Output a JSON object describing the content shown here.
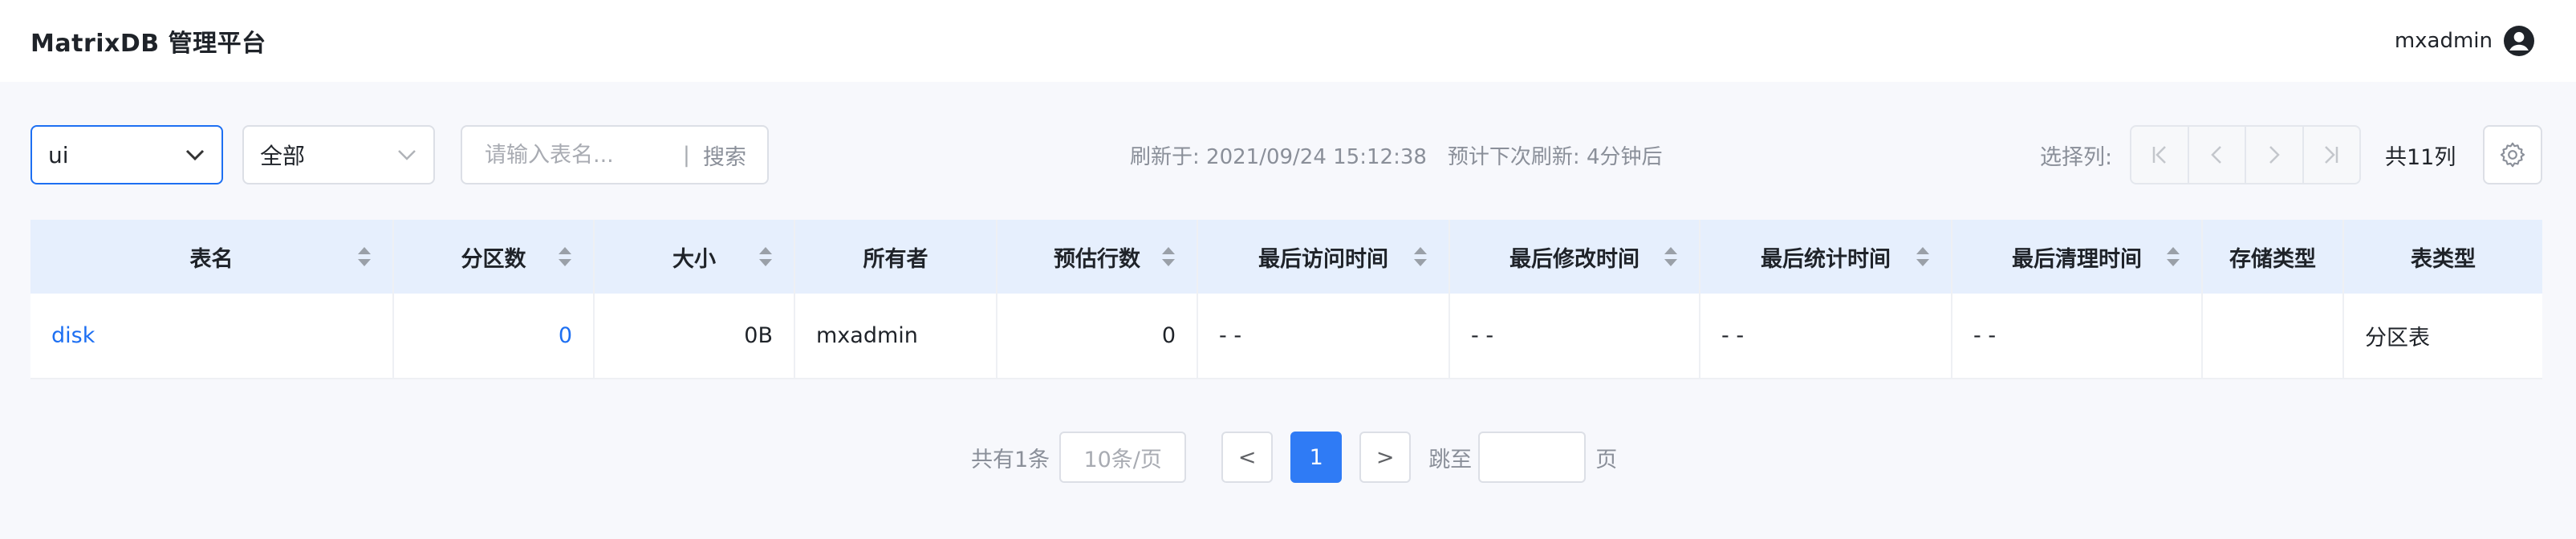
{
  "header": {
    "title": "MatrixDB 管理平台",
    "username": "mxadmin"
  },
  "toolbar": {
    "schema_value": "ui",
    "type_value": "全部",
    "search_placeholder": "请输入表名...",
    "search_button": "搜索",
    "refresh_text": "刷新于: 2021/09/24 15:12:38",
    "next_refresh_text": "预计下次刷新: 4分钟后",
    "select_columns_label": "选择列:",
    "column_count": "共11列"
  },
  "table": {
    "headers": [
      "表名",
      "分区数",
      "大小",
      "所有者",
      "预估行数",
      "最后访问时间",
      "最后修改时间",
      "最后统计时间",
      "最后清理时间",
      "存储类型",
      "表类型"
    ],
    "rows": [
      [
        "disk",
        "0",
        "0B",
        "mxadmin",
        "0",
        "- -",
        "- -",
        "- -",
        "- -",
        "",
        "分区表"
      ]
    ]
  },
  "pagination": {
    "total": "共有1条",
    "page_size": "10条/页",
    "prev": "<",
    "current": "1",
    "next": ">",
    "jump_label": "跳至",
    "unit": "页"
  },
  "colors": {
    "accent": "#1d6ff2",
    "header_bg": "#e6effd",
    "page_bg": "#f7f8fc"
  }
}
